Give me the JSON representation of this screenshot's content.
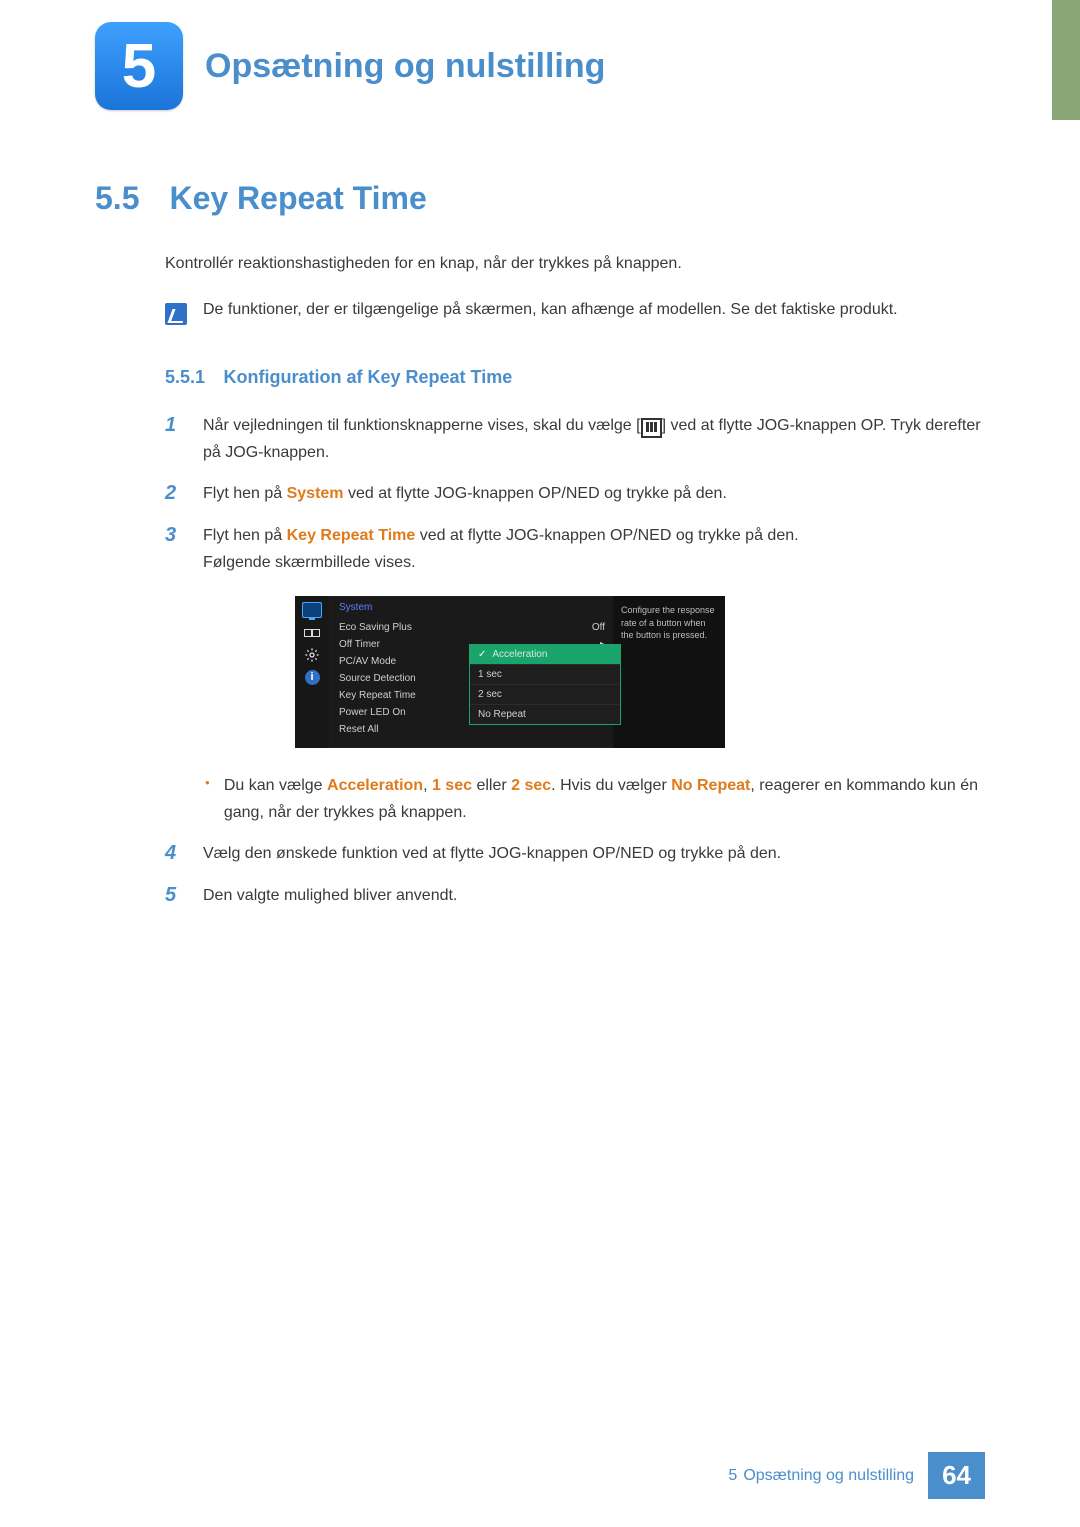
{
  "chapter": {
    "number": "5",
    "title": "Opsætning og nulstilling"
  },
  "section": {
    "number": "5.5",
    "title": "Key Repeat Time",
    "intro": "Kontrollér reaktionshastigheden for en knap, når der trykkes på knappen.",
    "note": "De funktioner, der er tilgængelige på skærmen, kan afhænge af modellen. Se det faktiske produkt."
  },
  "subsection": {
    "number": "5.5.1",
    "title": "Konfiguration af Key Repeat Time"
  },
  "steps": {
    "s1a": "Når vejledningen til funktionsknapperne vises, skal du vælge [",
    "s1b": "] ved at flytte JOG-knappen OP. Tryk derefter på JOG-knappen.",
    "s2a": "Flyt hen på ",
    "s2_system": "System",
    "s2b": " ved at flytte JOG-knappen OP/NED og trykke på den.",
    "s3a": "Flyt hen på ",
    "s3_krt": "Key Repeat Time",
    "s3b": " ved at flytte JOG-knappen OP/NED og trykke på den.",
    "s3c": "Følgende skærmbillede vises.",
    "bullet_a": "Du kan vælge ",
    "bullet_accel": "Acceleration",
    "bullet_sep1": ", ",
    "bullet_1sec": "1 sec",
    "bullet_or": " eller ",
    "bullet_2sec": "2 sec",
    "bullet_mid": ". Hvis du vælger ",
    "bullet_norep": "No Repeat",
    "bullet_b": ", reagerer en kommando kun én gang, når der trykkes på knappen.",
    "s4": "Vælg den ønskede funktion ved at flytte JOG-knappen OP/NED og trykke på den.",
    "s5": "Den valgte mulighed bliver anvendt."
  },
  "osd": {
    "section_label": "System",
    "rows": {
      "eco": "Eco Saving Plus",
      "eco_val": "Off",
      "offtimer": "Off Timer",
      "pcav": "PC/AV Mode",
      "srcdet": "Source Detection",
      "krt": "Key Repeat Time",
      "pled": "Power LED On",
      "reset": "Reset All"
    },
    "popup": {
      "accel": "Acceleration",
      "one": "1 sec",
      "two": "2 sec",
      "norep": "No Repeat"
    },
    "help": "Configure the response rate of a button when the button is pressed."
  },
  "footer": {
    "chapter_num": "5",
    "chapter_title": "Opsætning og nulstilling",
    "page": "64"
  }
}
